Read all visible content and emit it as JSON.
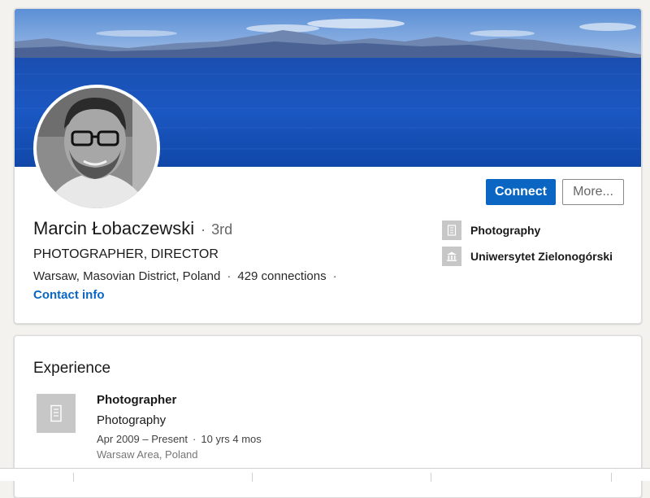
{
  "profile": {
    "name": "Marcin Łobaczewski",
    "separator": "·",
    "degree": "3rd",
    "headline": "PHOTOGRAPHER, DIRECTOR",
    "location": "Warsaw, Masovian District, Poland",
    "connections": "429 connections",
    "contact_info": "Contact info"
  },
  "actions": {
    "connect_label": "Connect",
    "more_label": "More..."
  },
  "side": {
    "items": [
      {
        "label": "Photography",
        "icon": "building-icon"
      },
      {
        "label": "Uniwersytet Zielonogórski",
        "icon": "school-icon"
      }
    ]
  },
  "experience": {
    "title": "Experience",
    "items": [
      {
        "role": "Photographer",
        "company": "Photography",
        "dates": "Apr 2009 – Present",
        "duration": "10 yrs 4 mos",
        "location": "Warsaw Area, Poland",
        "icon": "building-icon"
      }
    ]
  },
  "colors": {
    "accent": "#0a66c2",
    "background": "#f3f2ef",
    "logo_placeholder": "#c7c7c7"
  }
}
